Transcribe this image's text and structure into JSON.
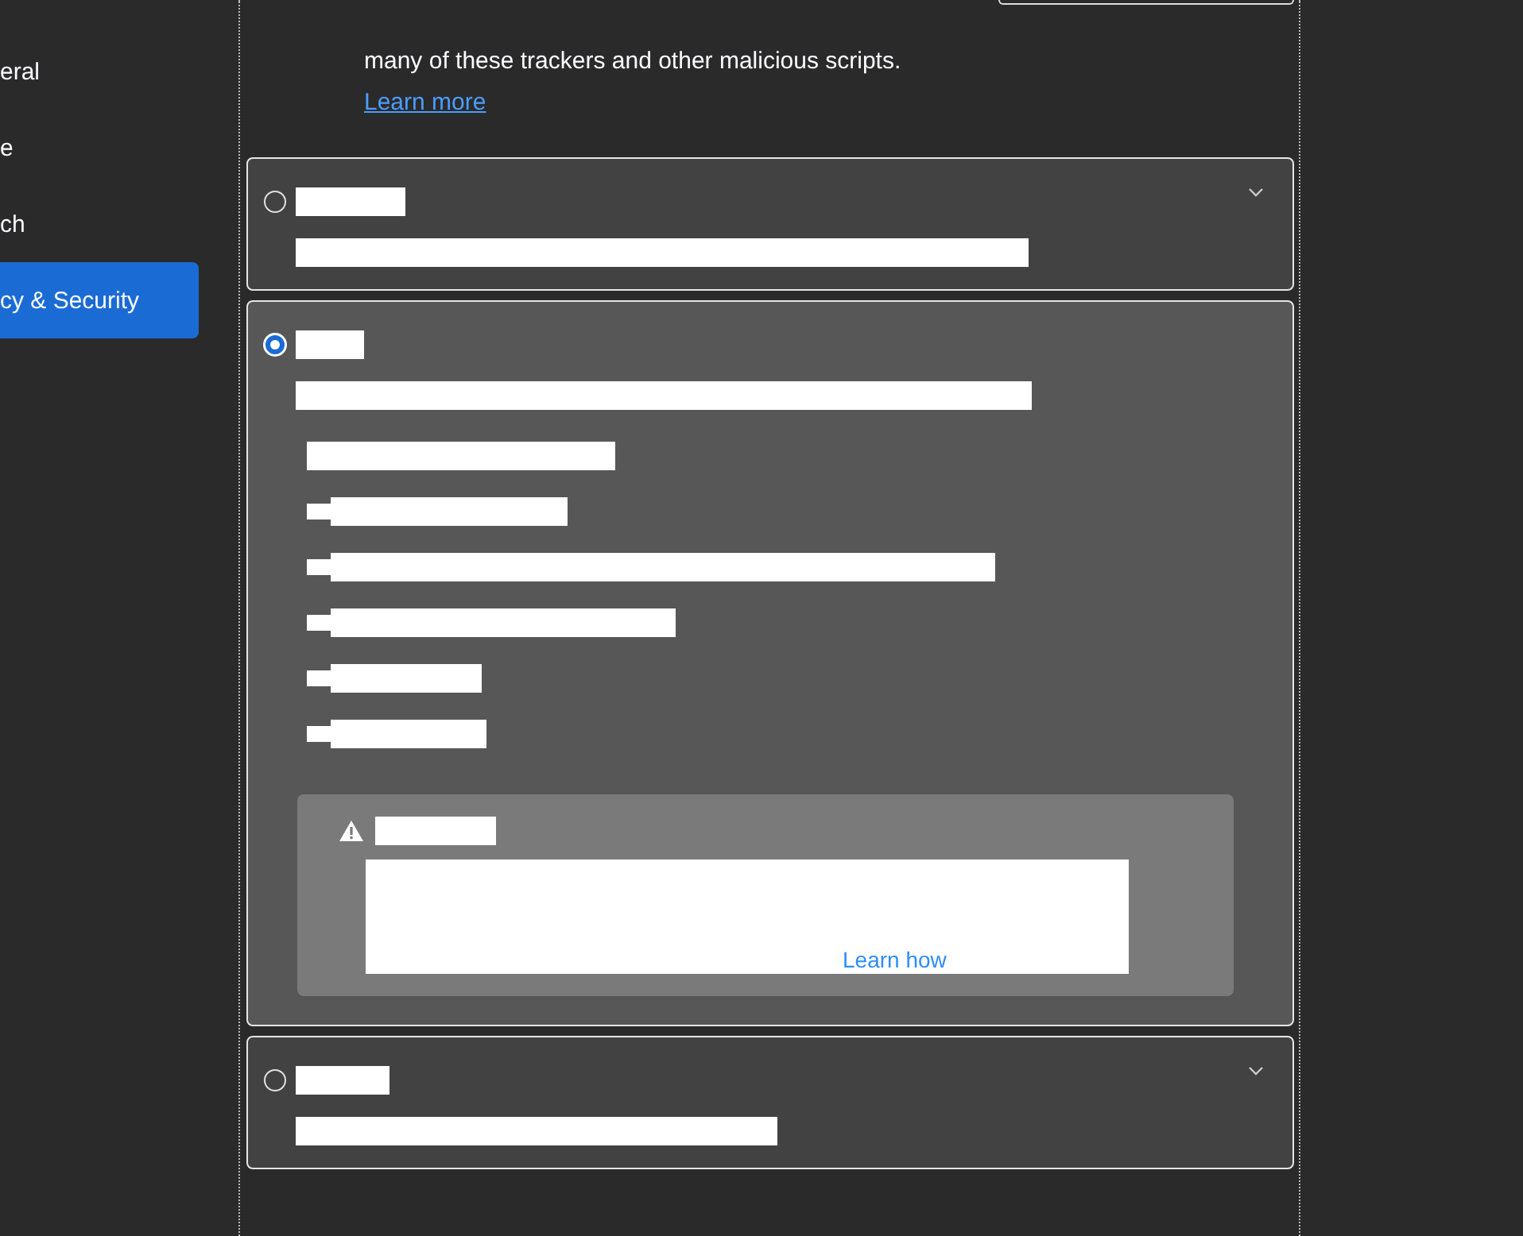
{
  "sidebar": {
    "items": [
      {
        "label": "eral",
        "selected": false
      },
      {
        "label": "e",
        "selected": false
      },
      {
        "label": "ch",
        "selected": false
      },
      {
        "label": "cy & Security",
        "selected": true
      }
    ]
  },
  "intro": {
    "text": "many of these trackers and other malicious scripts.",
    "link": "Learn more"
  },
  "cards": [
    {
      "selected": false,
      "expanded": false
    },
    {
      "selected": true,
      "expanded": true,
      "warning": {
        "link": "Learn how"
      }
    },
    {
      "selected": false,
      "expanded": false
    }
  ]
}
